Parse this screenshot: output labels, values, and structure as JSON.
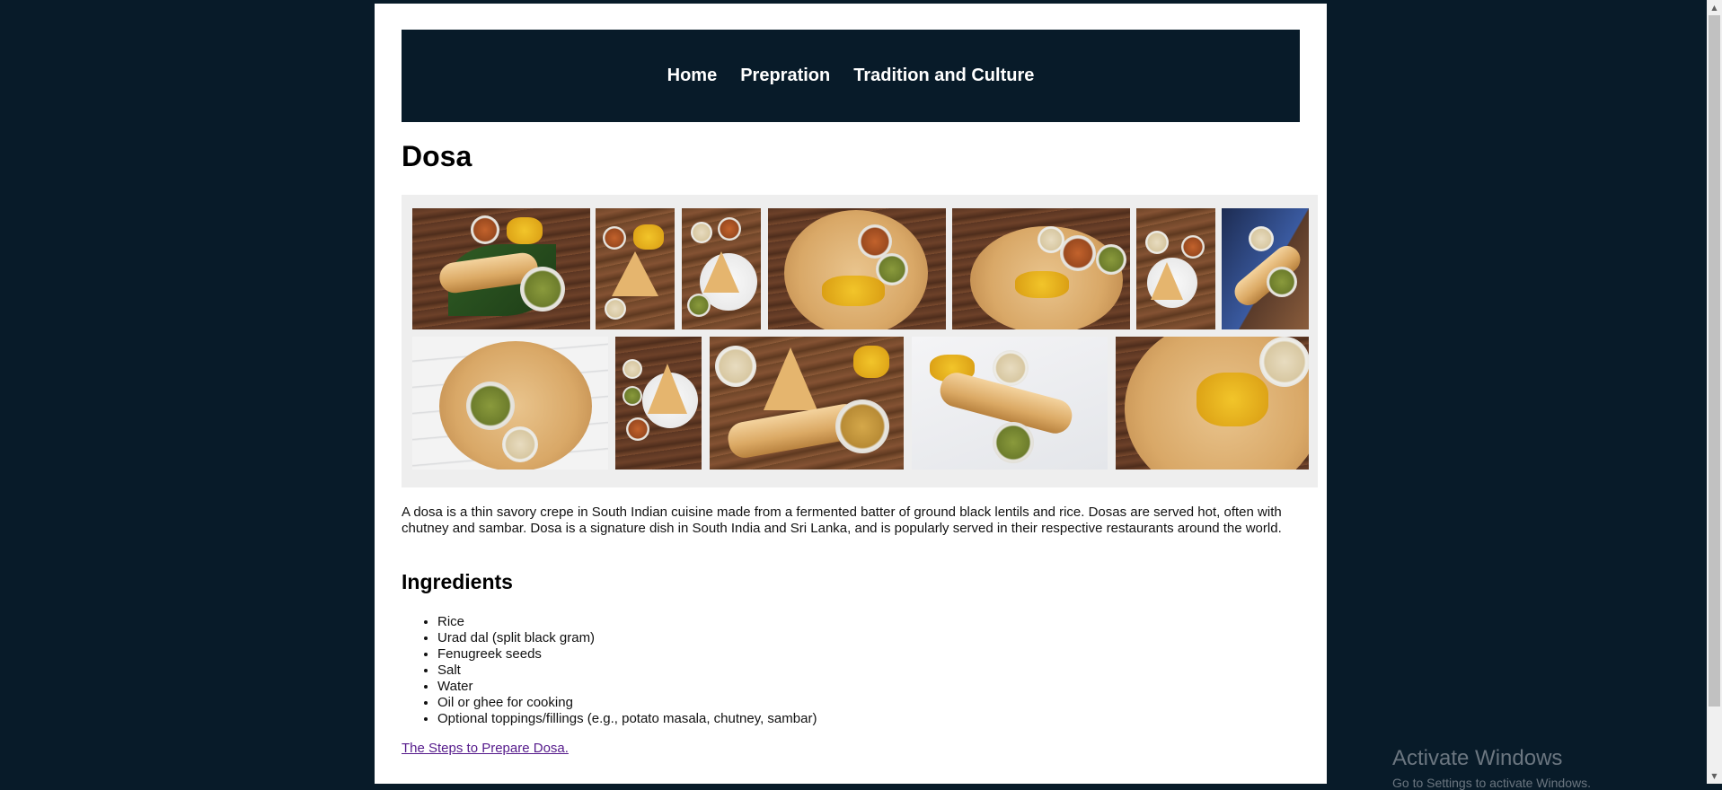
{
  "nav": {
    "items": [
      {
        "label": "Home"
      },
      {
        "label": "Prepration"
      },
      {
        "label": "Tradition and Culture"
      }
    ]
  },
  "page": {
    "title": "Dosa",
    "description": "A dosa is a thin savory crepe in South Indian cuisine made from a fermented batter of ground black lentils and rice. Dosas are served hot, often with chutney and sambar. Dosa is a signature dish in South India and Sri Lanka, and is popularly served in their respective restaurants around the world.",
    "ingredients_heading": "Ingredients",
    "ingredients": [
      "Rice",
      "Urad dal (split black gram)",
      "Fenugreek seeds",
      "Salt",
      "Water",
      "Oil or ghee for cooking",
      "Optional toppings/fillings (e.g., potato masala, chutney, sambar)"
    ],
    "steps_link": "The Steps to Prepare Dosa."
  },
  "gallery": {
    "photo_count": 12
  },
  "system": {
    "watermark_title": "Activate Windows",
    "watermark_sub": "Go to Settings to activate Windows."
  },
  "colors": {
    "background": "#081b29",
    "navbar": "#081b29",
    "content": "#ffffff",
    "gallery_bg": "#eeeeee",
    "visited_link": "#551a8b"
  }
}
